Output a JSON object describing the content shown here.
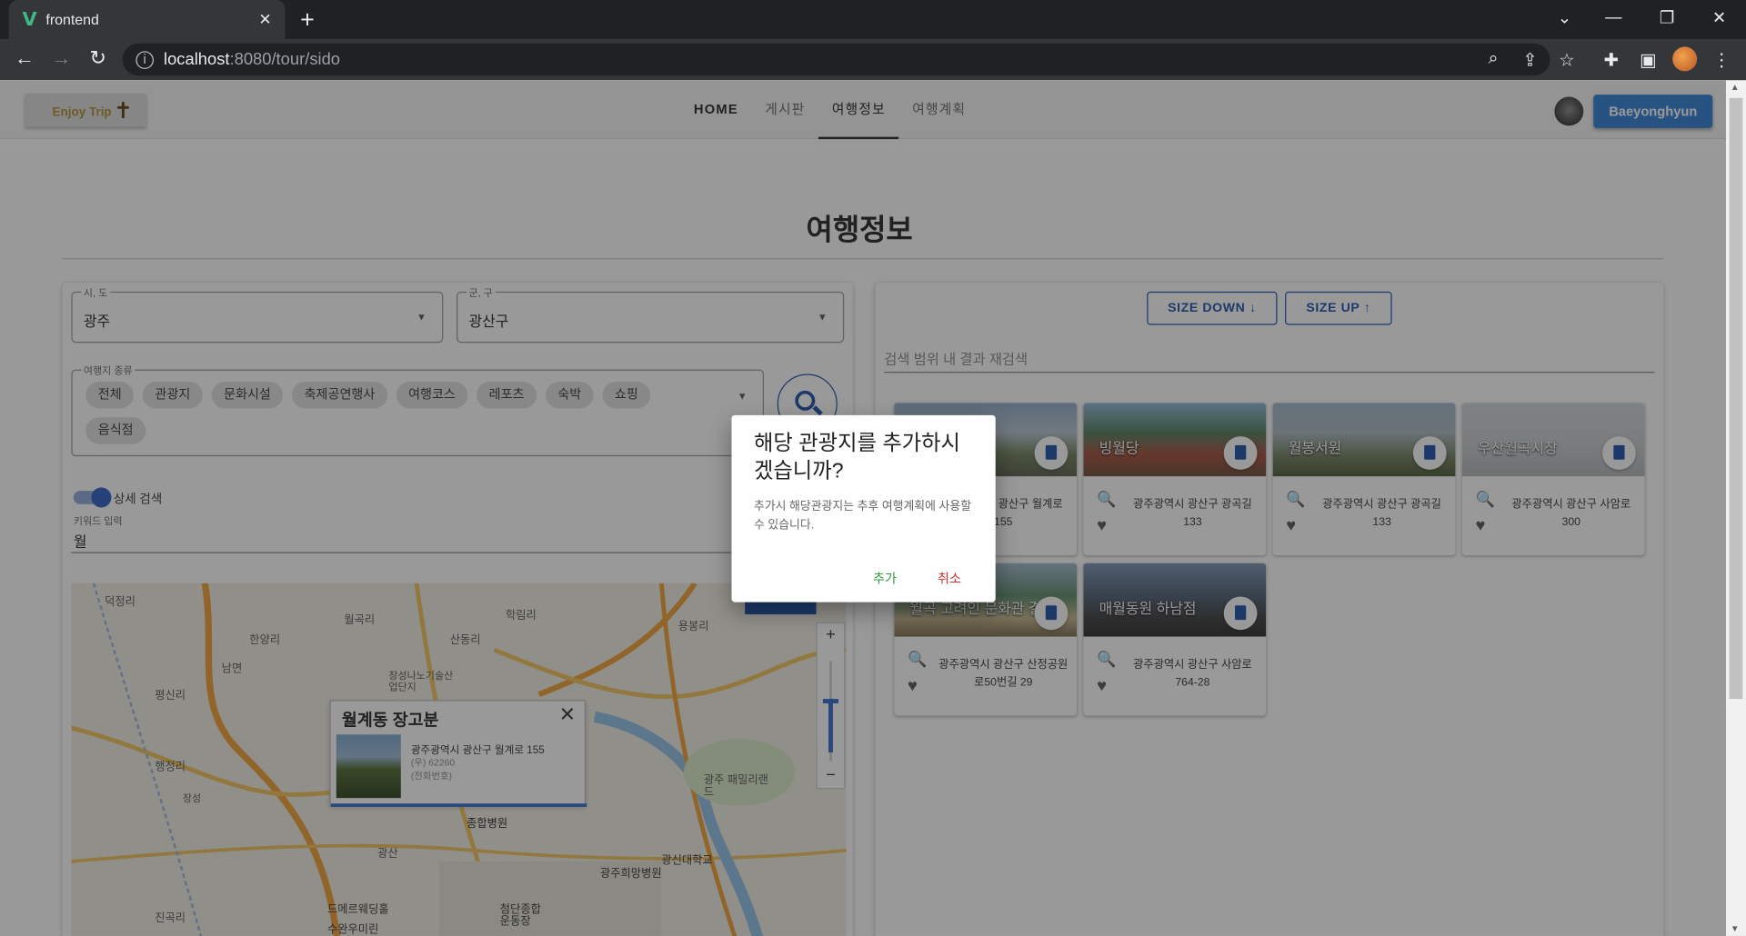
{
  "browser": {
    "tab_title": "frontend",
    "url_host": "localhost",
    "url_path": ":8080/tour/sido"
  },
  "header": {
    "brand": "Enjoy Trip",
    "nav": [
      "HOME",
      "게시판",
      "여행정보",
      "여행계획"
    ],
    "active_nav": "여행정보",
    "user": "Baeyonghyun"
  },
  "page_title": "여행정보",
  "filters": {
    "sido_label": "시, 도",
    "sido_value": "광주",
    "gugun_label": "군, 구",
    "gugun_value": "광산구",
    "type_label": "여행지 종류",
    "types": [
      "전체",
      "관광지",
      "문화시설",
      "축제공연행사",
      "여행코스",
      "레포츠",
      "숙박",
      "쇼핑",
      "음식점"
    ],
    "detail_search_label": "상세 검색",
    "keyword_label": "키워드 입력",
    "keyword_value": "월"
  },
  "map": {
    "labels": [
      "덕정리",
      "월곡리",
      "학림리",
      "용봉리",
      "남면",
      "한양리",
      "산동리",
      "평신리",
      "행정리",
      "진곡리",
      "광주 패밀리랜드",
      "종합병원",
      "광신대학교",
      "광주희망병원",
      "광산",
      "드메르웨딩홀",
      "수완우미린",
      "첨단종합운동장",
      "장성나노기술산업단지",
      "장성"
    ],
    "info": {
      "title": "월계동 장고분",
      "address": "광주광역시 광산구 월계로 155",
      "zip": "(우) 62260",
      "phone": "(전화번호)"
    }
  },
  "results": {
    "size_down": "SIZE DOWN",
    "size_up": "SIZE UP",
    "refine_placeholder": "검색 범위 내 결과 재검색",
    "cards": [
      {
        "name": "월계동 장고분",
        "addr": "광주광역시 광산구 월계로 155",
        "bg": "linear-gradient(#8fa9c6 0%,#b7c5d1 40%,#6f7f5a 70%,#565d4c 100%)"
      },
      {
        "name": "빙월당",
        "addr": "광주광역시 광산구 광곡길 133",
        "bg": "linear-gradient(#8fb7d9 0%,#4f7d5c 40%,#a24b3a 70%,#6a4a34 100%)"
      },
      {
        "name": "월봉서원",
        "addr": "광주광역시 광산구 광곡길 133",
        "bg": "linear-gradient(#9fb6c8 0%,#aab8c2 40%,#6d7a5a 75%,#4a5a34 100%)"
      },
      {
        "name": "우산월곡시장",
        "addr": "광주광역시 광산구 사암로 300",
        "bg": "linear-gradient(#cfd4d8 0%,#c5c9cc 60%,#b0b4b8 100%)"
      },
      {
        "name": "월곡 고려인 문화관 결",
        "addr": "광주광역시 광산구 산정공원로50번길 29",
        "bg": "linear-gradient(#9fb8cc 0%,#5b8a6a 45%,#c2b48a 75%,#7a6a4a 100%)"
      },
      {
        "name": "매월동원 하남점",
        "addr": "광주광역시 광산구 사암로 764-28",
        "bg": "linear-gradient(#7b93b0 0%,#4c5d74 45%,#3b3a3a 75%,#2a2a2a 100%)"
      }
    ]
  },
  "dialog": {
    "title": "해당 관광지를 추가하시겠습니까?",
    "text": "추가시 해당관광지는 추후 여행계획에 사용할 수 있습니다.",
    "confirm": "추가",
    "cancel": "취소"
  },
  "colors": {
    "accent": "#1a4fa8",
    "user_button": "#2e7fd6",
    "confirm": "#2e9b3a",
    "cancel": "#d32f2f"
  }
}
